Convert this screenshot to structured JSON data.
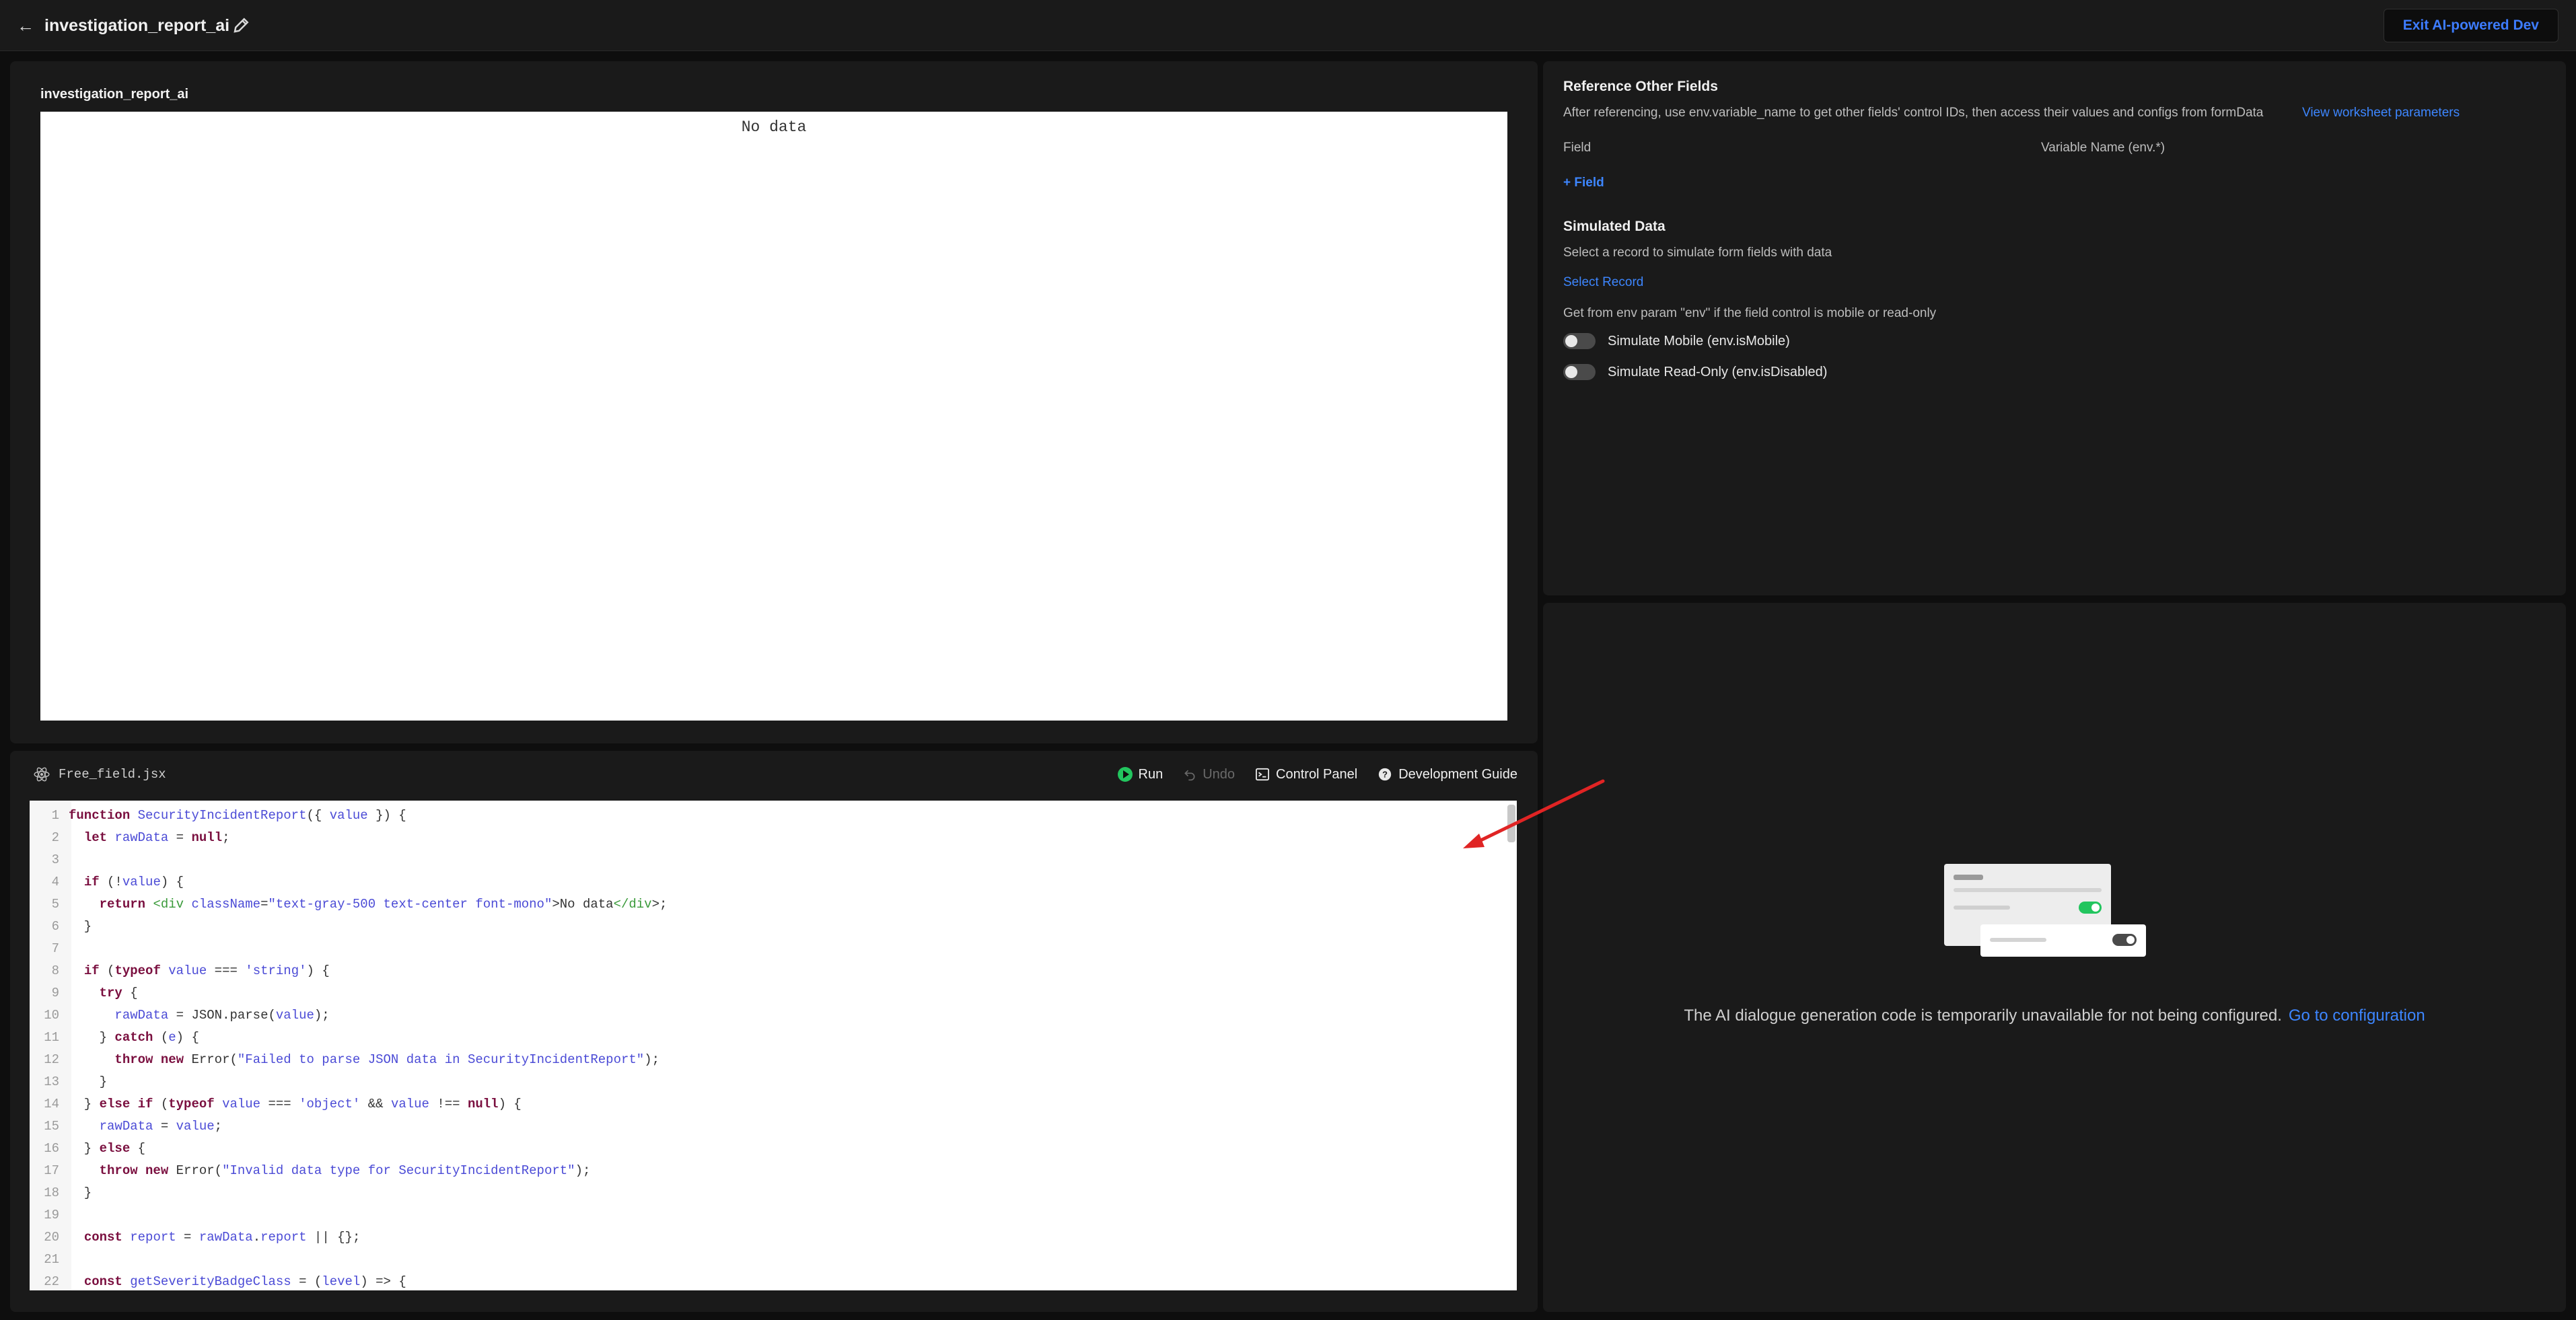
{
  "header": {
    "title": "investigation_report_ai",
    "exit_label": "Exit AI-powered Dev"
  },
  "preview": {
    "title": "investigation_report_ai",
    "no_data": "No data"
  },
  "editor": {
    "file_name": "Free_field.jsx",
    "toolbar": {
      "run": "Run",
      "undo": "Undo",
      "control_panel": "Control Panel",
      "dev_guide": "Development Guide"
    },
    "lines": [
      "function SecurityIncidentReport({ value }) {",
      "  let rawData = null;",
      "",
      "  if (!value) {",
      "    return <div className=\"text-gray-500 text-center font-mono\">No data</div>;",
      "  }",
      "",
      "  if (typeof value === 'string') {",
      "    try {",
      "      rawData = JSON.parse(value);",
      "    } catch (e) {",
      "      throw new Error(\"Failed to parse JSON data in SecurityIncidentReport\");",
      "    }",
      "  } else if (typeof value === 'object' && value !== null) {",
      "    rawData = value;",
      "  } else {",
      "    throw new Error(\"Invalid data type for SecurityIncidentReport\");",
      "  }",
      "",
      "  const report = rawData.report || {};",
      "",
      "  const getSeverityBadgeClass = (level) => {"
    ]
  },
  "reference": {
    "title": "Reference Other Fields",
    "desc": "After referencing, use env.variable_name to get other fields' control IDs, then access their values and configs from formData",
    "view_params_link": "View worksheet parameters",
    "col_field": "Field",
    "col_variable": "Variable Name (env.*)",
    "add_field": "Field"
  },
  "simulated": {
    "title": "Simulated Data",
    "desc": "Select a record to simulate form fields with data",
    "select_record": "Select Record",
    "env_note": "Get from env param \"env\" if the field control is mobile or read-only",
    "mobile_label": "Simulate Mobile (env.isMobile)",
    "readonly_label": "Simulate Read-Only (env.isDisabled)"
  },
  "ai": {
    "message": "The AI dialogue generation code is temporarily unavailable for not being configured.",
    "config_link": "Go to configuration"
  },
  "colors": {
    "accent": "#3d86ff",
    "run_green": "#22c55e",
    "annotation_arrow": "#e02424"
  }
}
